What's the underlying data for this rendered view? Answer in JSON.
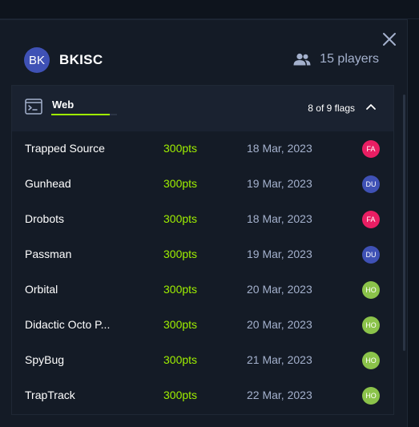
{
  "team": {
    "avatar_initials": "BK",
    "avatar_color": "#3f51b5",
    "name": "BKISC",
    "players_icon": "users-icon",
    "players_label": "15 players"
  },
  "close_icon": "close-icon",
  "category": {
    "icon": "terminal-icon",
    "label": "Web",
    "flags_label": "8 of 9 flags",
    "solved": 8,
    "total": 9,
    "toggle_icon": "chevron-up-icon"
  },
  "colors": {
    "accent_green": "#9fef00",
    "user_fa": "#e91e63",
    "user_du": "#3f51b5",
    "user_ho": "#8bc34a"
  },
  "challenges": [
    {
      "name": "Trapped Source",
      "points": "300pts",
      "date": "18 Mar, 2023",
      "user": "FA",
      "user_color": "#e91e63"
    },
    {
      "name": "Gunhead",
      "points": "300pts",
      "date": "19 Mar, 2023",
      "user": "DU",
      "user_color": "#3f51b5"
    },
    {
      "name": "Drobots",
      "points": "300pts",
      "date": "18 Mar, 2023",
      "user": "FA",
      "user_color": "#e91e63"
    },
    {
      "name": "Passman",
      "points": "300pts",
      "date": "19 Mar, 2023",
      "user": "DU",
      "user_color": "#3f51b5"
    },
    {
      "name": "Orbital",
      "points": "300pts",
      "date": "20 Mar, 2023",
      "user": "HO",
      "user_color": "#8bc34a"
    },
    {
      "name": "Didactic Octo P...",
      "points": "300pts",
      "date": "20 Mar, 2023",
      "user": "HO",
      "user_color": "#8bc34a"
    },
    {
      "name": "SpyBug",
      "points": "300pts",
      "date": "21 Mar, 2023",
      "user": "HO",
      "user_color": "#8bc34a"
    },
    {
      "name": "TrapTrack",
      "points": "300pts",
      "date": "22 Mar, 2023",
      "user": "HO",
      "user_color": "#8bc34a"
    }
  ]
}
